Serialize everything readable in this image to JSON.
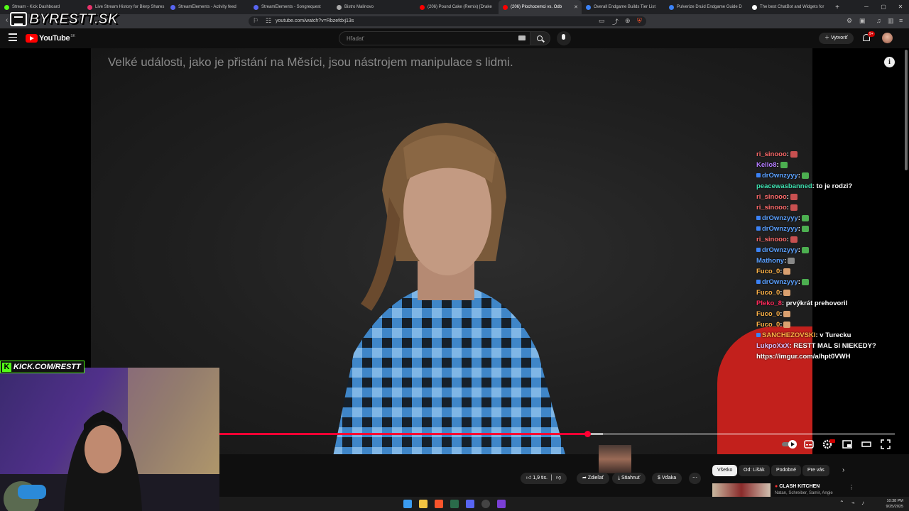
{
  "browser": {
    "tabs": [
      {
        "label": "Stream - Kick Dashboard",
        "color": "#53fc18",
        "active": false
      },
      {
        "label": "Live Stream History for Blerp Shares",
        "color": "#e8336b",
        "active": false
      },
      {
        "label": "StreamElements - Activity feed",
        "color": "#5865f2",
        "active": false
      },
      {
        "label": "StreamElements - Songrequest",
        "color": "#5865f2",
        "active": false
      },
      {
        "label": "Bistro Malinovo",
        "color": "#aaaaaa",
        "active": false
      },
      {
        "label": "(206) Pound Cake (Remix) [Drake",
        "color": "#ff0000",
        "active": false
      },
      {
        "label": "(206) Plochozemci vs. Odb",
        "color": "#ff0000",
        "active": true
      },
      {
        "label": "Overall Endgame Builds Tier List",
        "color": "#3b82f6",
        "active": false
      },
      {
        "label": "Pulverize Druid Endgame Guide D",
        "color": "#3b82f6",
        "active": false
      },
      {
        "label": "The best ChatBot and Widgets for",
        "color": "#ffffff",
        "active": false
      }
    ],
    "url": "youtube.com/watch?v=Rbzefdxj13s"
  },
  "youtube": {
    "logo_text": "YouTube",
    "country_code": "SK",
    "search_placeholder": "Hľadať",
    "create_label": "Vytvoriť",
    "notifications_badge": "9+"
  },
  "video": {
    "subtitle": "Velké události, jako je přistání na Měsíci, jsou nástrojem manipulace s lidmi.",
    "progress_played": 0.545,
    "progress_buffered": 0.568
  },
  "chat": [
    {
      "user": "ri_sinooo",
      "color": "#ff6b6b",
      "message": "",
      "emote": "#c85050",
      "badge": false
    },
    {
      "user": "Kello8",
      "color": "#b37bff",
      "message": "",
      "emote": "#4caf50",
      "badge": false
    },
    {
      "user": "drOwnzyyy",
      "color": "#5aa0ff",
      "message": "",
      "emote": "#4caf50",
      "badge": true
    },
    {
      "user": "peacewasbanned",
      "color": "#3fe0b0",
      "message": "to je rodzi?",
      "emote": "",
      "badge": false
    },
    {
      "user": "ri_sinooo",
      "color": "#ff6b6b",
      "message": "",
      "emote": "#c85050",
      "badge": false
    },
    {
      "user": "ri_sinooo",
      "color": "#ff6b6b",
      "message": "",
      "emote": "#c85050",
      "badge": false
    },
    {
      "user": "drOwnzyyy",
      "color": "#5aa0ff",
      "message": "",
      "emote": "#4caf50",
      "badge": true
    },
    {
      "user": "drOwnzyyy",
      "color": "#5aa0ff",
      "message": "",
      "emote": "#4caf50",
      "badge": true
    },
    {
      "user": "ri_sinooo",
      "color": "#ff6b6b",
      "message": "",
      "emote": "#c85050",
      "badge": false
    },
    {
      "user": "drOwnzyyy",
      "color": "#5aa0ff",
      "message": "",
      "emote": "#4caf50",
      "badge": true
    },
    {
      "user": "Mathony",
      "color": "#5aa0ff",
      "message": "",
      "emote": "#888888",
      "badge": false
    },
    {
      "user": "Fuco_0",
      "color": "#ffb347",
      "message": "",
      "emote": "#d9a070",
      "badge": false
    },
    {
      "user": "drOwnzyyy",
      "color": "#5aa0ff",
      "message": "",
      "emote": "#4caf50",
      "badge": true
    },
    {
      "user": "Fuco_0",
      "color": "#ffb347",
      "message": "",
      "emote": "#d9a070",
      "badge": false
    },
    {
      "user": "Pleko_8",
      "color": "#ff2a5a",
      "message": "prvýkrát prehovoril",
      "emote": "",
      "badge": false
    },
    {
      "user": "Fuco_0",
      "color": "#ffb347",
      "message": "",
      "emote": "#d9a070",
      "badge": false
    },
    {
      "user": "Fuco_0",
      "color": "#ffb347",
      "message": "",
      "emote": "#d9a070",
      "badge": false
    },
    {
      "user": "SANCHEZOVSKI",
      "color": "#ffb347",
      "message": "v Turecku",
      "emote": "",
      "badge": true
    },
    {
      "user": "LukpoXxX",
      "color": "#d8c0ff",
      "message": "RESTT MAL SI NIEKEDY?",
      "emote": "",
      "badge": false
    },
    {
      "user": "",
      "color": "#ffffff",
      "message": "https://imgur.com/a/hpt0VWH",
      "emote": "",
      "badge": false
    }
  ],
  "actions": {
    "likes": "1,9 tis.",
    "share": "Zdieľať",
    "download": "Stiahnuť",
    "thanks": "Vďaka",
    "more": "⋯"
  },
  "chips": [
    {
      "label": "Všetko",
      "active": true
    },
    {
      "label": "Od: Lišák",
      "active": false
    },
    {
      "label": "Podobné",
      "active": false
    },
    {
      "label": "Pre vás",
      "active": false
    }
  ],
  "recommended": {
    "title": "CLASH KITCHEN",
    "subtitle": "Natan, Schreiber, Samir, Angie"
  },
  "overlay": {
    "logo": "BYRESTT.SK",
    "kick_text": "KICK.COM/RESTT"
  },
  "taskbar": {
    "time": "10:38 PM",
    "date": "9/25/2025"
  }
}
